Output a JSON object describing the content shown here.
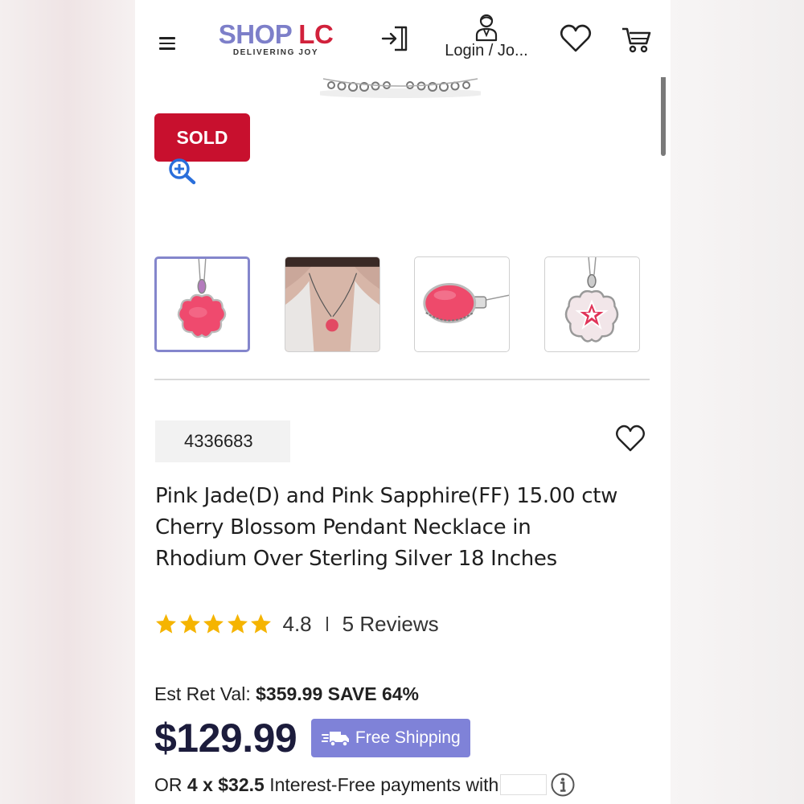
{
  "header": {
    "logo_shop": "SHOP",
    "logo_lc": "LC",
    "logo_tagline": "DELIVERING JOY",
    "account_label": "Login / Jo...",
    "icons": [
      "menu-icon",
      "login-icon",
      "user-icon",
      "heart-icon",
      "cart-icon"
    ]
  },
  "gallery": {
    "sold_label": "SOLD",
    "thumbnails": [
      {
        "name": "pendant-front",
        "active": true
      },
      {
        "name": "pendant-worn",
        "active": false
      },
      {
        "name": "pendant-side",
        "active": false
      },
      {
        "name": "pendant-back",
        "active": false
      }
    ]
  },
  "product": {
    "sku": "4336683",
    "title_lines": [
      "Pink Jade(D) and Pink Sapphire(FF) 15.00 ctw",
      "Cherry Blossom Pendant Necklace in",
      "Rhodium Over Sterling Silver 18 Inches"
    ],
    "rating": {
      "stars": 5,
      "value": "4.8",
      "separator": "I",
      "reviews_label": "5 Reviews"
    },
    "est_label": "Est Ret Val:",
    "est_value": "$359.99",
    "save_label": "SAVE 64%",
    "price": "$129.99",
    "shipping_label": "Free Shipping",
    "installments": {
      "prefix": "OR",
      "amount": "4 x $32.5",
      "suffix": "Interest-Free payments with"
    }
  },
  "colors": {
    "brand_purple": "#7d7fc9",
    "brand_red": "#d1213b",
    "sold_red": "#c8102e",
    "shipping_badge": "#7f82d8",
    "star_gold": "#f5b400",
    "price_navy": "#1c1c3c"
  }
}
